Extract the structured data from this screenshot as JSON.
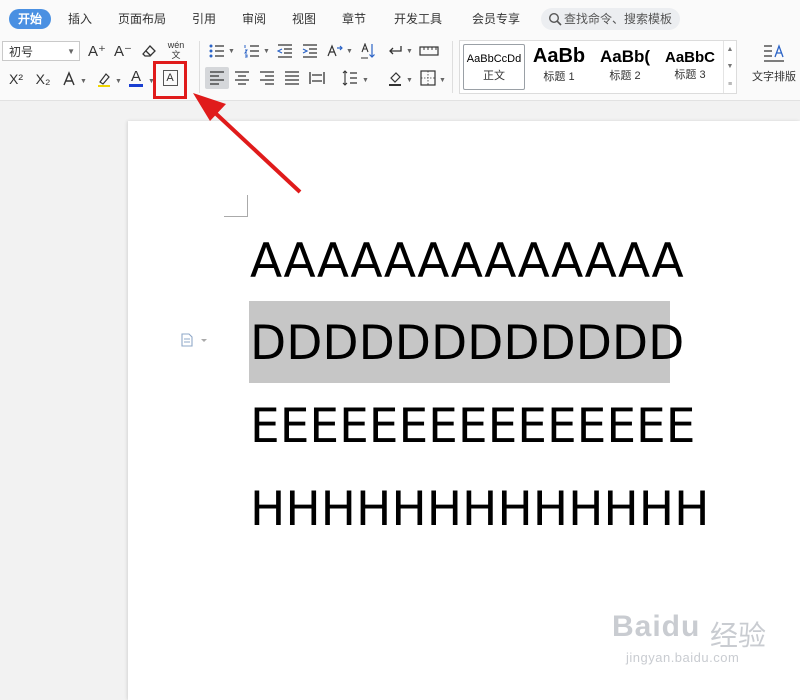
{
  "tabs": [
    {
      "label": "开始",
      "active": true
    },
    {
      "label": "插入"
    },
    {
      "label": "页面布局"
    },
    {
      "label": "引用"
    },
    {
      "label": "审阅"
    },
    {
      "label": "视图"
    },
    {
      "label": "章节"
    },
    {
      "label": "开发工具"
    },
    {
      "label": "会员专享"
    }
  ],
  "search": {
    "placeholder": "查找命令、搜索模板",
    "icon": "search-icon"
  },
  "font": {
    "size_value": "初号",
    "grow_label": "A⁺",
    "shrink_label": "A⁻",
    "clear_format_icon": "eraser-icon",
    "phonetic_label": "wén 文",
    "superscript_label": "X²",
    "subscript_label": "X₂",
    "text_effect_icon": "text-effect-icon",
    "highlight_icon": "highlighter-icon",
    "font_color_label": "A",
    "font_color": "#1a3fd1",
    "char_border_label": "A"
  },
  "paragraph_icons": [
    "bullets-icon",
    "numbering-icon",
    "decrease-indent-icon",
    "increase-indent-icon",
    "text-direction-icon",
    "sort-icon",
    "show-marks-icon",
    "table-borders-icon",
    "align-left-icon",
    "align-center-icon",
    "align-right-icon",
    "justify-icon",
    "distributed-icon",
    "line-spacing-icon",
    "shading-icon",
    "borders-icon"
  ],
  "styles": [
    {
      "sample": "AaBbCcDd",
      "name": "正文",
      "selected": true
    },
    {
      "sample": "AaBb",
      "name": "标题 1"
    },
    {
      "sample": "AaBb(",
      "name": "标题 2"
    },
    {
      "sample": "AaBbC",
      "name": "标题 3"
    }
  ],
  "text_layout": {
    "label": "文字排版"
  },
  "document": {
    "lines": [
      {
        "text": "AAAAAAAAAAAAA",
        "selected": false
      },
      {
        "text": "DDDDDDDDDDDD",
        "selected": true
      },
      {
        "text": "EEEEEEEEEEEEEEE",
        "selected": false
      },
      {
        "text": "HHHHHHHHHHHHH",
        "selected": false
      }
    ]
  },
  "annotation": {
    "highlight_color": "#e01b1b",
    "arrow_color": "#e01b1b"
  },
  "watermark": {
    "logo": "Baidu",
    "cn": "经验",
    "url": "jingyan.baidu.com"
  },
  "colors": {
    "accent": "#4a90e2",
    "selection": "#c6c6c6"
  }
}
